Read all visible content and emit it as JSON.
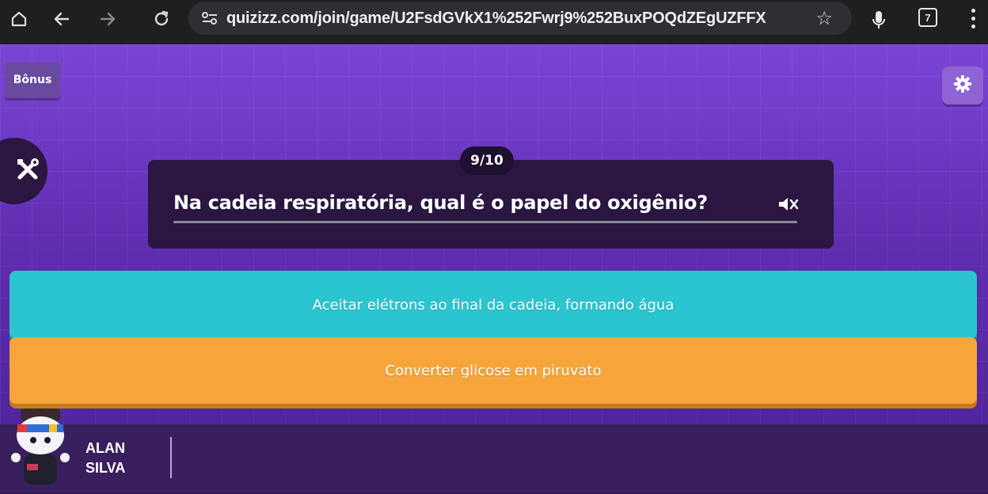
{
  "browser": {
    "url": "quizizz.com/join/game/U2FsdGVkX1%252Fwrj9%252BuxPOQdZEgUZFFX",
    "tab_count": "7",
    "icons": {
      "home": "home-icon",
      "back": "back-arrow-icon",
      "forward": "forward-arrow-icon",
      "reload": "reload-icon",
      "site_info": "site-info-icon",
      "bookmark": "star-icon",
      "voice": "microphone-icon",
      "menu": "kebab-menu-icon"
    }
  },
  "game": {
    "bonus_label": "Bônus",
    "question_counter": "9/10",
    "question": "Na cadeia respiratória, qual é o papel do oxigênio?",
    "options": [
      {
        "text": "Aceitar elétrons ao final da cadeia, formando água",
        "color": "#2bc5cf"
      },
      {
        "text": "Converter glicose em piruvato",
        "color": "#f5a53a"
      }
    ],
    "player": {
      "first_name": "ALAN",
      "last_name": "SILVA"
    },
    "colors": {
      "background": "#5f2db0",
      "card": "#2a1640",
      "settings_button": "#8e64d4"
    }
  }
}
